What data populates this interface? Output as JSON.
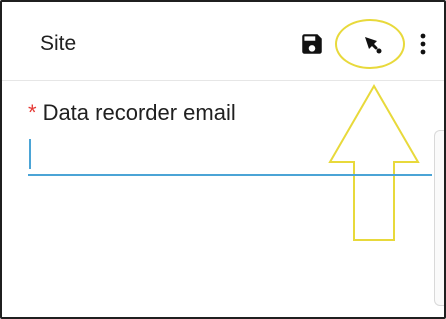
{
  "appbar": {
    "title": "Site",
    "actions": [
      "save-icon",
      "pin-location-icon",
      "more-vert-icon"
    ]
  },
  "form": {
    "required_marker": "*",
    "field_label": "Data recorder email",
    "field_value": ""
  },
  "colors": {
    "accent": "#4ba4d6",
    "required": "#e53935",
    "annotation": "#e8d93b",
    "text": "#202020"
  }
}
